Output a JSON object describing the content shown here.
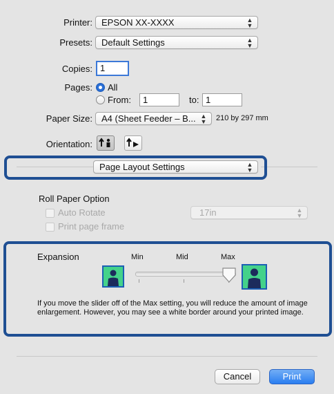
{
  "printer": {
    "label": "Printer:",
    "value": "EPSON XX-XXXX"
  },
  "presets": {
    "label": "Presets:",
    "value": "Default Settings"
  },
  "copies": {
    "label": "Copies:",
    "value": "1"
  },
  "pages": {
    "label": "Pages:",
    "all_label": "All",
    "from_label": "From:",
    "from_value": "1",
    "to_label": "to:",
    "to_value": "1",
    "selected": "All"
  },
  "paper_size": {
    "label": "Paper Size:",
    "value": "A4 (Sheet Feeder – B...",
    "dimensions": "210 by 297 mm"
  },
  "orientation": {
    "label": "Orientation:",
    "selected": "portrait"
  },
  "section_popup": {
    "value": "Page Layout Settings"
  },
  "roll_paper": {
    "title": "Roll Paper Option",
    "auto_rotate_label": "Auto Rotate",
    "auto_rotate_checked": false,
    "print_frame_label": "Print page frame",
    "print_frame_checked": false,
    "width_value": "17in"
  },
  "expansion": {
    "label": "Expansion",
    "min_label": "Min",
    "mid_label": "Mid",
    "max_label": "Max",
    "slider_level": "Max",
    "description": "If you move the slider off of the Max setting, you will reduce the amount of image enlargement. However, you may see a white border around your printed image."
  },
  "buttons": {
    "cancel": "Cancel",
    "print": "Print"
  },
  "colors": {
    "highlight": "#1f4f93",
    "accent": "#2a7ef0",
    "icon_fill": "#44d28a"
  },
  "icons": [
    "popup-arrows-icon",
    "portrait-icon",
    "landscape-icon",
    "person-min-icon",
    "person-max-icon",
    "slider-thumb-icon"
  ]
}
